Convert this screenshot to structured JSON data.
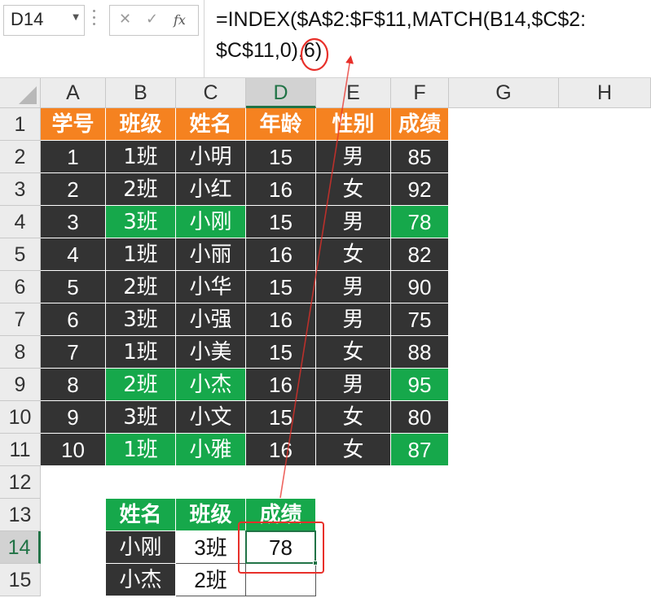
{
  "formula_bar": {
    "name_box": "D14",
    "cancel_symbol": "✕",
    "enter_symbol": "✓",
    "fx_label": "fx",
    "formula_line1": "=INDEX($A$2:$F$11,MATCH(B14,$C$2:",
    "formula_line2": "$C$11,0),6)"
  },
  "columns": [
    "A",
    "B",
    "C",
    "D",
    "E",
    "F",
    "G",
    "H"
  ],
  "selected_column": "D",
  "rows": [
    "1",
    "2",
    "3",
    "4",
    "5",
    "6",
    "7",
    "8",
    "9",
    "10",
    "11",
    "12",
    "13",
    "14",
    "15"
  ],
  "selected_row": "14",
  "main_table": {
    "headers": [
      "学号",
      "班级",
      "姓名",
      "年龄",
      "性别",
      "成绩"
    ],
    "rows": [
      [
        "1",
        "1班",
        "小明",
        "15",
        "男",
        "85"
      ],
      [
        "2",
        "2班",
        "小红",
        "16",
        "女",
        "92"
      ],
      [
        "3",
        "3班",
        "小刚",
        "15",
        "男",
        "78"
      ],
      [
        "4",
        "1班",
        "小丽",
        "16",
        "女",
        "82"
      ],
      [
        "5",
        "2班",
        "小华",
        "15",
        "男",
        "90"
      ],
      [
        "6",
        "3班",
        "小强",
        "16",
        "男",
        "75"
      ],
      [
        "7",
        "1班",
        "小美",
        "15",
        "女",
        "88"
      ],
      [
        "8",
        "2班",
        "小杰",
        "16",
        "男",
        "95"
      ],
      [
        "9",
        "3班",
        "小文",
        "15",
        "女",
        "80"
      ],
      [
        "10",
        "1班",
        "小雅",
        "16",
        "女",
        "87"
      ]
    ],
    "highlighted_rows": [
      "3",
      "8",
      "10"
    ]
  },
  "lookup_table": {
    "headers": [
      "姓名",
      "班级",
      "成绩"
    ],
    "rows": [
      [
        "小刚",
        "3班",
        "78"
      ],
      [
        "小杰",
        "2班",
        ""
      ]
    ]
  },
  "active_cell": "D14",
  "colors": {
    "header_orange": "#f58220",
    "dark_row": "#333333",
    "highlight_green": "#16a84b",
    "excel_green": "#217346",
    "annotation_red": "#e8302a"
  }
}
